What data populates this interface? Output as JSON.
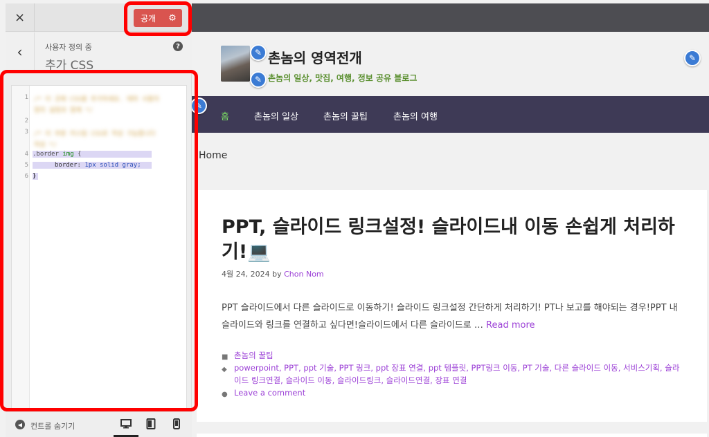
{
  "sidebar": {
    "close_icon": "×",
    "publish_label": "공개",
    "publish_gear_icon": "⚙",
    "back_icon": "‹",
    "crumb": "사용자 정의 중",
    "title": "추가 CSS",
    "help_icon": "?",
    "editor": {
      "line_numbers": [
        "1",
        "2",
        "3",
        "4",
        "5",
        "6"
      ],
      "blurred_line_1a": "/* 이 곳에 CSS를 추가하세요. 테마 사용자",
      "blurred_line_1b": "정의 설정과 함께 */",
      "blurred_line_3a": "/* 이 부분 커스텀 CSS로 작성 가능합니다",
      "blurred_line_3b": "작성 */",
      "line4_selector": ".border ",
      "line4_tag": "img",
      "line4_brace": " {",
      "line5_prop": "border: ",
      "line5_value": "1px solid gray;",
      "line6": "}"
    },
    "footer": {
      "collapse_label": "컨트롤 숨기기",
      "collapse_icon": "◀",
      "devices": [
        "desktop",
        "tablet",
        "mobile"
      ]
    }
  },
  "preview": {
    "site_title": "촌놈의 영역전개",
    "site_description": "촌놈의 일상, 맛집, 여행, 정보 공유 블로그",
    "nav": [
      "홈",
      "촌놈의 일상",
      "촌놈의 꿀팁",
      "촌놈의 여행"
    ],
    "breadcrumb": "Home",
    "post": {
      "title": "PPT, 슬라이드 링크설정! 슬라이드내 이동 손쉽게 처리하기!💻",
      "date": "4월 24, 2024",
      "by": " by ",
      "author": "Chon Nom",
      "excerpt": "PPT 슬라이드에서 다른 슬라이드로 이동하기! 슬라이드 링크설정 간단하게 처리하기! PT나 보고를 해야되는 경우!PPT 내 슬라이드와 링크를 연결하고 싶다면!슬라이드에서 다른 슬라이드로 … ",
      "read_more": "Read more",
      "category": "촌놈의 꿀팁",
      "tags": "powerpoint, PPT, ppt 기술, PPT 링크, ppt 장표 연결, ppt 템플릿, PPT링크 이동, PT 기술, 다른 슬라이드 이동, 서비스기획, 슬라이드 링크연결, 슬라이드 이동, 슬라이드링크, 슬라이드연결, 장표 연결",
      "comment": "Leave a comment"
    }
  },
  "colors": {
    "publish": "#d9544f",
    "highlight": "#ff0000",
    "nav_bg": "#3e3a56",
    "nav_active": "#7bdc64",
    "link": "#9b3fd6",
    "edit_pen": "#3b7bd4"
  },
  "icons": {
    "close": "close-icon",
    "gear": "gear-icon",
    "back": "chevron-left-icon",
    "help": "help-icon",
    "pencil": "pencil-icon",
    "folder": "folder-icon",
    "tag": "tag-icon",
    "comment": "comment-icon"
  }
}
